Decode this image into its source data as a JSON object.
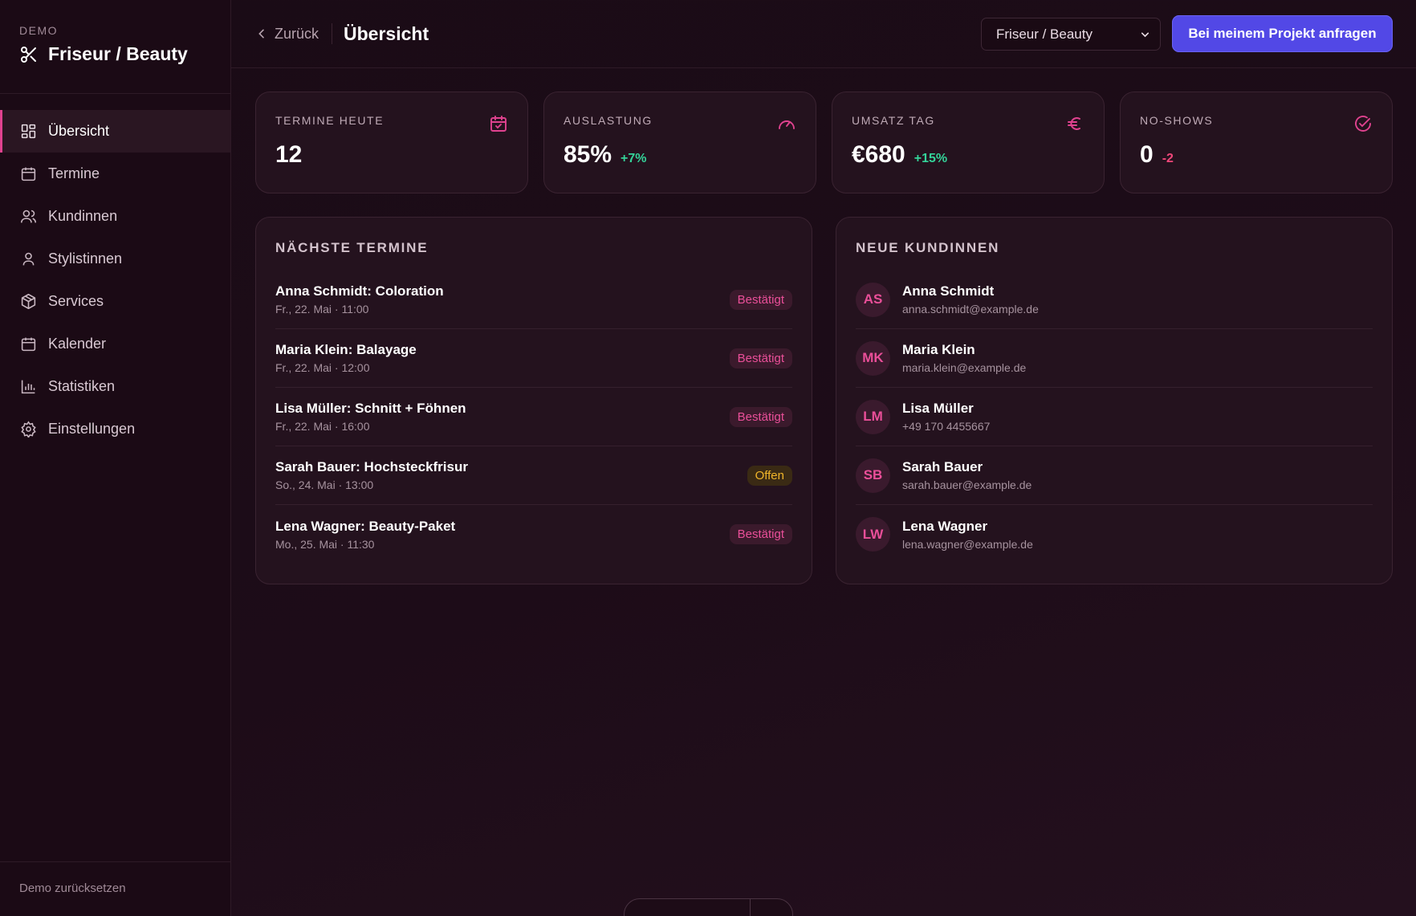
{
  "sidebar": {
    "brand_label": "DEMO",
    "brand_name": "Friseur / Beauty",
    "brand_icon": "scissors-icon",
    "items": [
      {
        "label": "Übersicht",
        "icon": "grid-icon",
        "active": true
      },
      {
        "label": "Termine",
        "icon": "calendar-icon",
        "active": false
      },
      {
        "label": "Kundinnen",
        "icon": "users-icon",
        "active": false
      },
      {
        "label": "Stylistinnen",
        "icon": "user-icon",
        "active": false
      },
      {
        "label": "Services",
        "icon": "box-icon",
        "active": false
      },
      {
        "label": "Kalender",
        "icon": "calendar-grid-icon",
        "active": false
      },
      {
        "label": "Statistiken",
        "icon": "bar-chart-icon",
        "active": false
      },
      {
        "label": "Einstellungen",
        "icon": "gear-icon",
        "active": false
      }
    ],
    "footer": "Demo zurücksetzen"
  },
  "topbar": {
    "back_label": "Zurück",
    "title": "Übersicht",
    "select_value": "Friseur / Beauty",
    "cta_label": "Bei meinem Projekt anfragen"
  },
  "stats": [
    {
      "label": "TERMINE HEUTE",
      "value": "12",
      "delta": "",
      "icon": "calendar-check-icon"
    },
    {
      "label": "AUSLASTUNG",
      "value": "85%",
      "delta": "+7%",
      "icon": "gauge-icon"
    },
    {
      "label": "UMSATZ TAG",
      "value": "€680",
      "delta": "+15%",
      "icon": "euro-icon"
    },
    {
      "label": "NO-SHOWS",
      "value": "0",
      "delta": "-2",
      "icon": "check-circle-icon"
    }
  ],
  "appointments": {
    "title": "NÄCHSTE TERMINE",
    "items": [
      {
        "title": "Anna Schmidt: Coloration",
        "time": "Fr., 22. Mai · 11:00",
        "status": "Bestätigt"
      },
      {
        "title": "Maria Klein: Balayage",
        "time": "Fr., 22. Mai · 12:00",
        "status": "Bestätigt"
      },
      {
        "title": "Lisa Müller: Schnitt + Föhnen",
        "time": "Fr., 22. Mai · 16:00",
        "status": "Bestätigt"
      },
      {
        "title": "Sarah Bauer: Hochsteckfrisur",
        "time": "So., 24. Mai · 13:00",
        "status": "Offen"
      },
      {
        "title": "Lena Wagner: Beauty-Paket",
        "time": "Mo., 25. Mai · 11:30",
        "status": "Bestätigt"
      }
    ]
  },
  "customers": {
    "title": "NEUE KUNDINNEN",
    "items": [
      {
        "initials": "AS",
        "name": "Anna Schmidt",
        "contact": "anna.schmidt@example.de"
      },
      {
        "initials": "MK",
        "name": "Maria Klein",
        "contact": "maria.klein@example.de"
      },
      {
        "initials": "LM",
        "name": "Lisa Müller",
        "contact": "+49 170 4455667"
      },
      {
        "initials": "SB",
        "name": "Sarah Bauer",
        "contact": "sarah.bauer@example.de"
      },
      {
        "initials": "LW",
        "name": "Lena Wagner",
        "contact": "lena.wagner@example.de"
      }
    ]
  },
  "colors": {
    "accent": "#e0428f",
    "positive": "#34d399",
    "negative": "#f0477a",
    "cta": "#5248e6"
  }
}
